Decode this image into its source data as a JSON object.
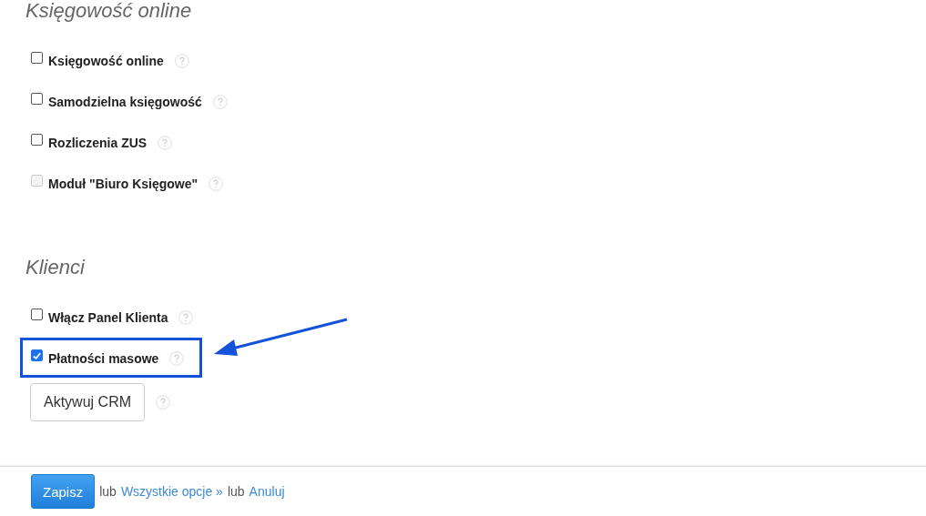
{
  "sections": [
    {
      "title": "Księgowość online",
      "items": [
        {
          "kind": "checkbox",
          "label": "Księgowość online",
          "checked": false,
          "disabled": false,
          "highlighted": false
        },
        {
          "kind": "checkbox",
          "label": "Samodzielna księgowość",
          "checked": false,
          "disabled": false,
          "highlighted": false
        },
        {
          "kind": "checkbox",
          "label": "Rozliczenia ZUS",
          "checked": false,
          "disabled": false,
          "highlighted": false
        },
        {
          "kind": "checkbox",
          "label": "Moduł \"Biuro Księgowe\"",
          "checked": false,
          "disabled": true,
          "highlighted": false
        }
      ]
    },
    {
      "title": "Klienci",
      "items": [
        {
          "kind": "checkbox",
          "label": "Włącz Panel Klienta",
          "checked": false,
          "disabled": false,
          "highlighted": false
        },
        {
          "kind": "checkbox",
          "label": "Płatności masowe",
          "checked": true,
          "disabled": false,
          "highlighted": true
        },
        {
          "kind": "button",
          "label": "Aktywuj CRM"
        }
      ]
    }
  ],
  "footer": {
    "save": "Zapisz",
    "or_1": "lub",
    "all_options": "Wszystkie opcje »",
    "or_2": "lub",
    "cancel": "Anuluj"
  }
}
